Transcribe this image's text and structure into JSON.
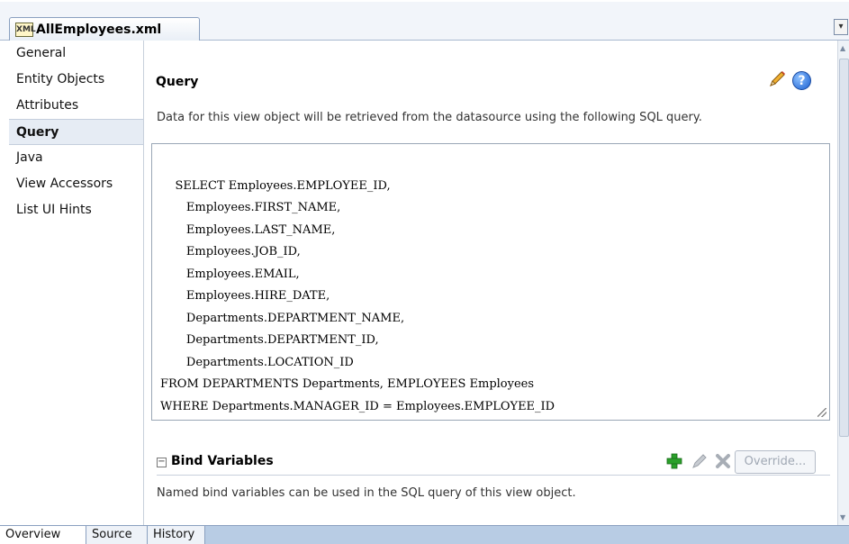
{
  "editor": {
    "file_tab_label": "AllEmployees.xml",
    "file_icon_text": "XML"
  },
  "nav": {
    "items": [
      {
        "label": "General",
        "active": false
      },
      {
        "label": "Entity Objects",
        "active": false
      },
      {
        "label": "Attributes",
        "active": false
      },
      {
        "label": "Query",
        "active": true
      },
      {
        "label": "Java",
        "active": false
      },
      {
        "label": "View Accessors",
        "active": false
      },
      {
        "label": "List UI Hints",
        "active": false
      }
    ]
  },
  "query": {
    "title": "Query",
    "description": "Data for this view object will be retrieved from the datasource using the following SQL query.",
    "sql": "SELECT Employees.EMPLOYEE_ID,\n       Employees.FIRST_NAME,\n       Employees.LAST_NAME,\n       Employees.JOB_ID,\n       Employees.EMAIL,\n       Employees.HIRE_DATE,\n       Departments.DEPARTMENT_NAME,\n       Departments.DEPARTMENT_ID,\n       Departments.LOCATION_ID\nFROM DEPARTMENTS Departments, EMPLOYEES Employees\nWHERE Departments.MANAGER_ID = Employees.EMPLOYEE_ID",
    "help_icon_glyph": "?"
  },
  "bind_variables": {
    "collapse_glyph": "−",
    "title": "Bind Variables",
    "override_label": "Override...",
    "description": "Named bind variables can be used in the SQL query of this view object."
  },
  "bottom_tabs": [
    {
      "label": "Overview",
      "active": true
    },
    {
      "label": "Source",
      "active": false
    },
    {
      "label": "History",
      "active": false
    }
  ],
  "colors": {
    "accent_blue": "#1a5fd0",
    "add_green": "#2aa02a",
    "tab_bar": "#b8cce4"
  }
}
